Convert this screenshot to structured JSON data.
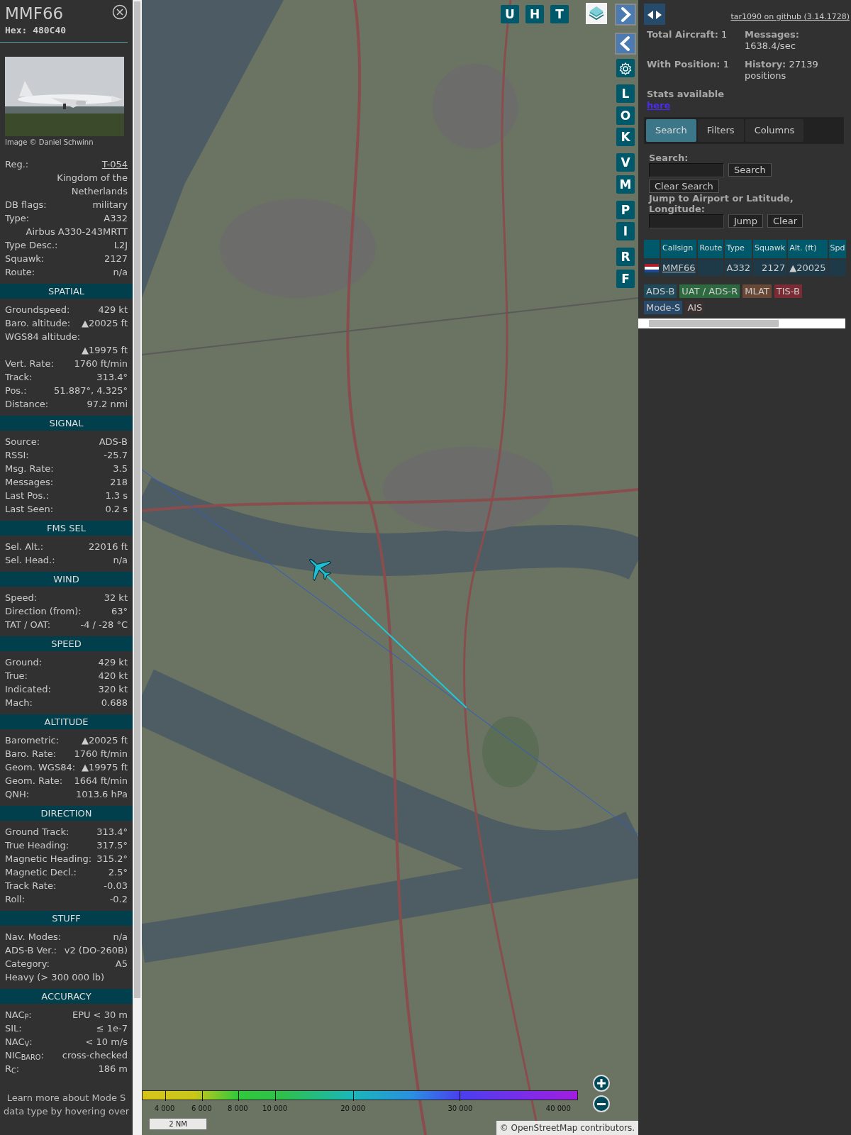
{
  "details": {
    "callsign": "MMF66",
    "hex": "Hex: 480C40",
    "photo_credit": "Image © Daniel Schwinn",
    "sections": [
      {
        "rows": [
          {
            "kind": "link",
            "label": "Reg.:",
            "value": "T-054"
          },
          {
            "kind": "value",
            "value": "Kingdom of the Netherlands"
          },
          {
            "kind": "pair",
            "label": "DB flags:",
            "value": "military"
          },
          {
            "kind": "pair",
            "label": "Type:",
            "value": "A332"
          },
          {
            "kind": "value",
            "value": "Airbus A330-243MRTT"
          },
          {
            "kind": "pair",
            "label": "Type Desc.:",
            "value": "L2J"
          },
          {
            "kind": "pair",
            "label": "Squawk:",
            "value": "2127"
          },
          {
            "kind": "pair",
            "label": "Route:",
            "value": "n/a"
          }
        ]
      },
      {
        "title": "SPATIAL",
        "rows": [
          {
            "kind": "pair",
            "label": "Groundspeed:",
            "value": "429 kt"
          },
          {
            "kind": "pair",
            "label": "Baro. altitude:",
            "value": "▲20025 ft"
          },
          {
            "kind": "stacked",
            "label": "WGS84 altitude:",
            "value": "▲19975 ft"
          },
          {
            "kind": "pair",
            "label": "Vert. Rate:",
            "value": "1760 ft/min"
          },
          {
            "kind": "pair",
            "label": "Track:",
            "value": "313.4°"
          },
          {
            "kind": "pair",
            "label": "Pos.:",
            "value": "51.887°, 4.325°"
          },
          {
            "kind": "pair",
            "label": "Distance:",
            "value": "97.2 nmi"
          }
        ]
      },
      {
        "title": "SIGNAL",
        "rows": [
          {
            "kind": "pair",
            "label": "Source:",
            "value": "ADS-B"
          },
          {
            "kind": "pair",
            "label": "RSSI:",
            "value": "-25.7"
          },
          {
            "kind": "pair",
            "label": "Msg. Rate:",
            "value": "3.5"
          },
          {
            "kind": "pair",
            "label": "Messages:",
            "value": "218"
          },
          {
            "kind": "pair",
            "label": "Last Pos.:",
            "value": "1.3 s"
          },
          {
            "kind": "pair",
            "label": "Last Seen:",
            "value": "0.2 s"
          }
        ]
      },
      {
        "title": "FMS SEL",
        "rows": [
          {
            "kind": "pair",
            "label": "Sel. Alt.:",
            "value": "22016 ft"
          },
          {
            "kind": "pair",
            "label": "Sel. Head.:",
            "value": "n/a"
          }
        ]
      },
      {
        "title": "WIND",
        "rows": [
          {
            "kind": "pair",
            "label": "Speed:",
            "value": "32 kt"
          },
          {
            "kind": "pair",
            "label": "Direction (from):",
            "value": "63°"
          },
          {
            "kind": "pair",
            "label": "TAT / OAT:",
            "value": "-4 / -28 °C"
          }
        ]
      },
      {
        "title": "SPEED",
        "rows": [
          {
            "kind": "pair",
            "label": "Ground:",
            "value": "429 kt"
          },
          {
            "kind": "pair",
            "label": "True:",
            "value": "420 kt"
          },
          {
            "kind": "pair",
            "label": "Indicated:",
            "value": "320 kt"
          },
          {
            "kind": "pair",
            "label": "Mach:",
            "value": "0.688"
          }
        ]
      },
      {
        "title": "ALTITUDE",
        "rows": [
          {
            "kind": "pair",
            "label": "Barometric:",
            "value": "▲20025 ft"
          },
          {
            "kind": "pair",
            "label": "Baro. Rate:",
            "value": "1760 ft/min"
          },
          {
            "kind": "pair",
            "label": "Geom. WGS84:",
            "value": "▲19975 ft"
          },
          {
            "kind": "pair",
            "label": "Geom. Rate:",
            "value": "1664 ft/min"
          },
          {
            "kind": "pair",
            "label": "QNH:",
            "value": "1013.6 hPa"
          }
        ]
      },
      {
        "title": "DIRECTION",
        "rows": [
          {
            "kind": "pair",
            "label": "Ground Track:",
            "value": "313.4°"
          },
          {
            "kind": "pair",
            "label": "True Heading:",
            "value": "317.5°"
          },
          {
            "kind": "pair",
            "label": "Magnetic Heading:",
            "value": "315.2°"
          },
          {
            "kind": "pair",
            "label": "Magnetic Decl.:",
            "value": "2.5°"
          },
          {
            "kind": "pair",
            "label": "Track Rate:",
            "value": "-0.03"
          },
          {
            "kind": "pair",
            "label": "Roll:",
            "value": "-0.2"
          }
        ]
      },
      {
        "title": "STUFF",
        "rows": [
          {
            "kind": "pair",
            "label": "Nav. Modes:",
            "value": "n/a"
          },
          {
            "kind": "pair",
            "label": "ADS-B Ver.:",
            "value": "v2 (DO-260B)"
          },
          {
            "kind": "pair",
            "label": "Category:",
            "value": "A5"
          },
          {
            "kind": "label",
            "label": "Heavy (> 300 000 lb)"
          }
        ]
      },
      {
        "title": "ACCURACY",
        "rows": [
          {
            "kind": "pair",
            "label": "NAC$_{P}$:",
            "value": "EPU < 30 m"
          },
          {
            "kind": "pair",
            "label": "SIL:",
            "value": "≤ 1e-7"
          },
          {
            "kind": "pair",
            "label": "NAC$_{V}$:",
            "value": "< 10 m/s"
          },
          {
            "kind": "pair",
            "label": "NIC$_{BARO}$:",
            "value": "cross-checked"
          },
          {
            "kind": "pair",
            "label": "R$_{C}$:",
            "value": "186 m"
          }
        ]
      }
    ],
    "footer": "Learn more about Mode S data type by hovering over"
  },
  "map": {
    "top_buttons": [
      "U",
      "H",
      "T"
    ],
    "side_groups": [
      [
        "L",
        "O",
        "K"
      ],
      [
        "V",
        "M"
      ],
      [
        "P",
        "I"
      ],
      [
        "R",
        "F"
      ]
    ],
    "legend": [
      "4 000",
      "6 000",
      "8 000",
      "10 000",
      "20 000",
      "30 000",
      "40 000"
    ],
    "scale": "2 NM",
    "attribution": {
      "prefix": "©",
      "link": "OpenStreetMap",
      "suffix": "contributors."
    }
  },
  "panel": {
    "github_link": "tar1090 on github (3.14.1728)",
    "stats": [
      {
        "label": "Total Aircraft:",
        "value": "1"
      },
      {
        "label": "Messages:",
        "value": "1638.4/sec"
      },
      {
        "label": "With Position:",
        "value": "1"
      },
      {
        "label": "History:",
        "value": "27139 positions"
      }
    ],
    "stats_note": "Stats available",
    "stats_link": "here",
    "tabs": [
      {
        "label": "Search",
        "selected": true
      },
      {
        "label": "Filters",
        "selected": false
      },
      {
        "label": "Columns",
        "selected": false
      }
    ],
    "search": {
      "label": "Search:",
      "button": "Search",
      "clear": "Clear Search"
    },
    "jump": {
      "label": "Jump to Airport or Latitude, Longitude:",
      "button": "Jump",
      "clear": "Clear"
    },
    "table": {
      "columns": [
        "Callsign",
        "Route",
        "Type",
        "Squawk",
        "Alt. (ft)",
        "Spd"
      ],
      "rows": [
        {
          "callsign": "MMF66",
          "type": "A332",
          "squawk": "2127",
          "altitude": "▲20025"
        }
      ]
    },
    "sources": [
      {
        "label": "ADS-B",
        "color": "#1f4a5a"
      },
      {
        "label": "UAT / ADS-R",
        "color": "#2d6a40"
      },
      {
        "label": "MLAT",
        "color": "#6a4836"
      },
      {
        "label": "TIS-B",
        "color": "#7a2b33"
      },
      {
        "label": "Mode-S",
        "color": "#29496a"
      },
      {
        "label": "AIS",
        "color": "#3a3030"
      }
    ]
  }
}
